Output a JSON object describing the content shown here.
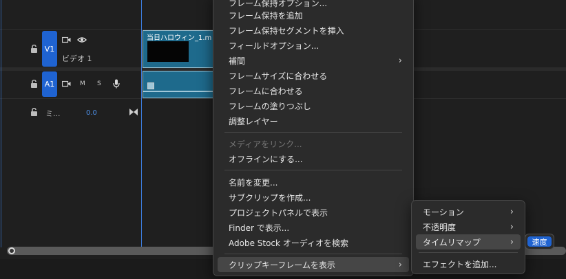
{
  "tracks": {
    "v1": {
      "target": "V1",
      "name": "ビデオ 1",
      "icons": [
        "film-icon",
        "eye-icon"
      ]
    },
    "a1": {
      "target": "A1",
      "m": "M",
      "s": "S",
      "icons": [
        "film-icon",
        "mic-icon"
      ]
    },
    "mix": {
      "name": "ミ...",
      "volume": "0.0"
    }
  },
  "clips": {
    "video_title": "当日ハロウィン_1.m"
  },
  "context_menu": {
    "items": [
      {
        "label": "フレーム保持オプション...",
        "disabled": false
      },
      {
        "label": "フレーム保持を追加",
        "disabled": false
      },
      {
        "label": "フレーム保持セグメントを挿入",
        "disabled": false
      },
      {
        "label": "フィールドオプション...",
        "disabled": false
      },
      {
        "label": "補間",
        "disabled": false,
        "submenu": true
      },
      {
        "label": "フレームサイズに合わせる",
        "disabled": false
      },
      {
        "label": "フレームに合わせる",
        "disabled": false
      },
      {
        "label": "フレームの塗りつぶし",
        "disabled": false
      },
      {
        "label": "調整レイヤー",
        "disabled": false
      },
      {
        "label": "メディアをリンク...",
        "disabled": true
      },
      {
        "label": "オフラインにする...",
        "disabled": false
      },
      {
        "label": "名前を変更...",
        "disabled": false
      },
      {
        "label": "サブクリップを作成...",
        "disabled": false
      },
      {
        "label": "プロジェクトパネルで表示",
        "disabled": false
      },
      {
        "label": "Finder で表示...",
        "disabled": false
      },
      {
        "label": "Adobe Stock オーディオを検索",
        "disabled": false
      },
      {
        "label": "クリップキーフレームを表示",
        "disabled": false,
        "submenu": true,
        "highlighted": true
      }
    ]
  },
  "submenu": {
    "items": [
      {
        "label": "モーション",
        "submenu": true
      },
      {
        "label": "不透明度",
        "submenu": true
      },
      {
        "label": "タイムリマップ",
        "submenu": true,
        "highlighted": true
      },
      {
        "label": "エフェクトを追加...",
        "submenu": false
      }
    ]
  },
  "speed_button": {
    "label": "速度"
  },
  "colors": {
    "accent": "#1f63d1",
    "clip": "#1e6a8c",
    "menu_bg": "#2b2b2b"
  }
}
